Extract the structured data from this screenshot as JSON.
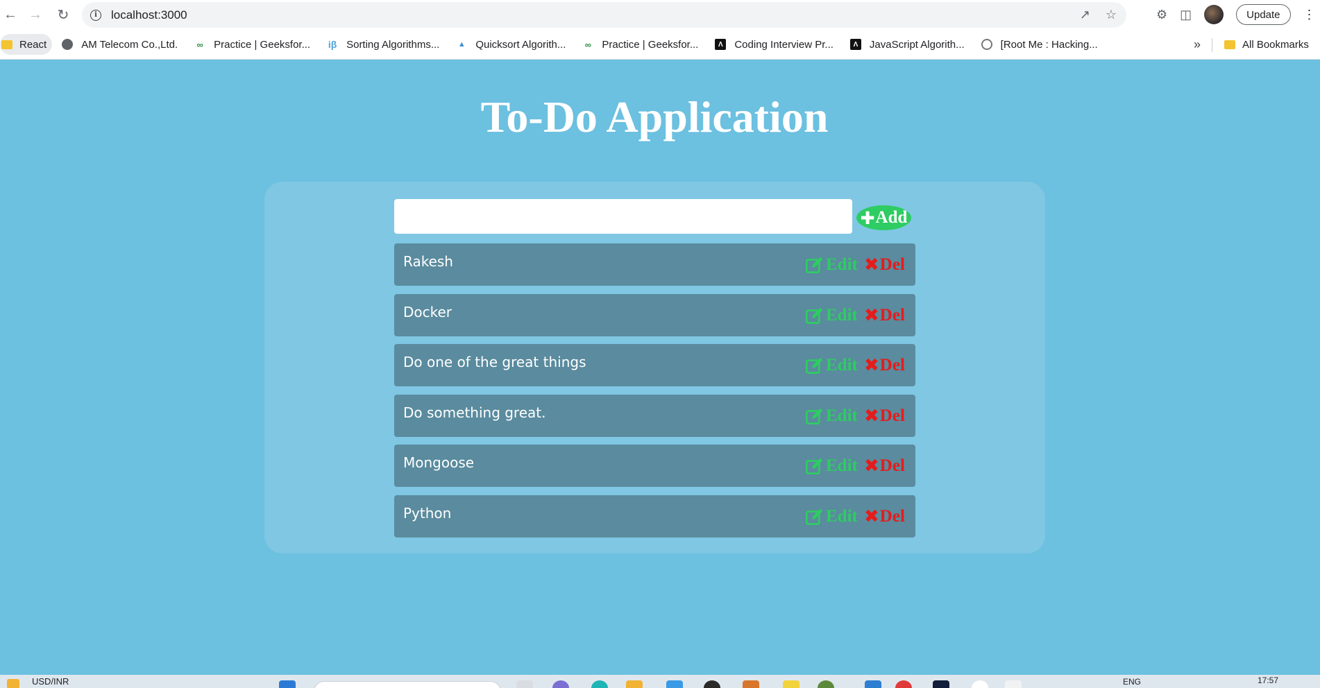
{
  "browser": {
    "url": "localhost:3000",
    "update_label": "Update",
    "bookmarks": [
      {
        "label": "React",
        "icon": "folder-icon"
      },
      {
        "label": "AM Telecom Co.,Ltd.",
        "icon": "globe-icon"
      },
      {
        "label": "Practice | Geeksfor...",
        "icon": "geeksforgeeks-icon"
      },
      {
        "label": "Sorting Algorithms...",
        "icon": "interviewbit-icon"
      },
      {
        "label": "Quicksort Algorith...",
        "icon": "chart-icon"
      },
      {
        "label": "Practice | Geeksfor...",
        "icon": "geeksforgeeks-icon"
      },
      {
        "label": "Coding Interview Pr...",
        "icon": "algoexpert-icon"
      },
      {
        "label": "JavaScript Algorith...",
        "icon": "algoexpert-icon"
      },
      {
        "label": "[Root Me : Hacking...",
        "icon": "rootme-icon"
      }
    ],
    "overflow_label": "»",
    "all_bookmarks_label": "All Bookmarks"
  },
  "app": {
    "title": "To-Do Application",
    "input_value": "",
    "add_label": "Add",
    "edit_label": "Edit",
    "delete_label": "Del",
    "todos": [
      "Rakesh",
      "Docker",
      "Do one of the great things",
      "Do something great.",
      "Mongoose",
      "Python"
    ],
    "colors": {
      "background": "#6cc0e0",
      "panel": "#7fc7e3",
      "item": "#5a8b9e",
      "add_button": "#2ecc63",
      "edit": "#2ecc63",
      "delete": "#e61b1b"
    }
  },
  "taskbar": {
    "ticker": "USD/INR",
    "language": "ENG",
    "time": "17:57"
  }
}
